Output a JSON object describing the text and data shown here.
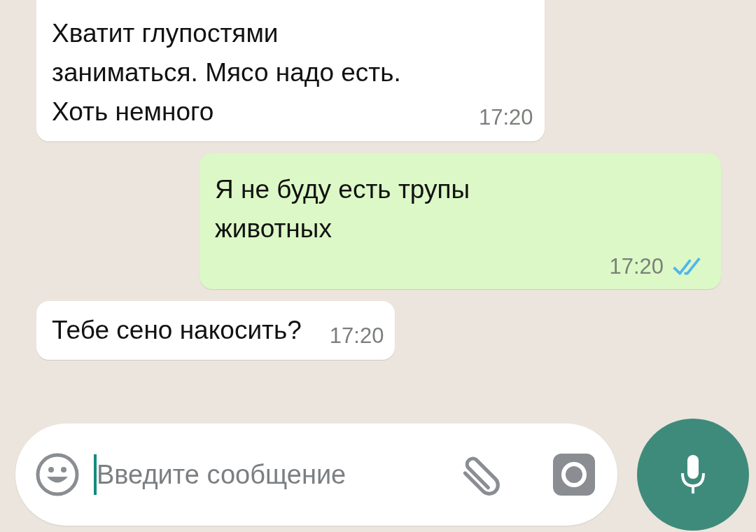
{
  "messages": [
    {
      "outgoing": false,
      "text": "Хватит глупостями заниматься. Мясо надо есть. Хоть немного",
      "time": "17:20"
    },
    {
      "outgoing": true,
      "text": "Я не буду есть трупы животных",
      "time": "17:20",
      "read": true
    },
    {
      "outgoing": false,
      "text": "Тебе сено накосить?",
      "time": "17:20"
    }
  ],
  "composer": {
    "placeholder": "Введите сообщение"
  }
}
